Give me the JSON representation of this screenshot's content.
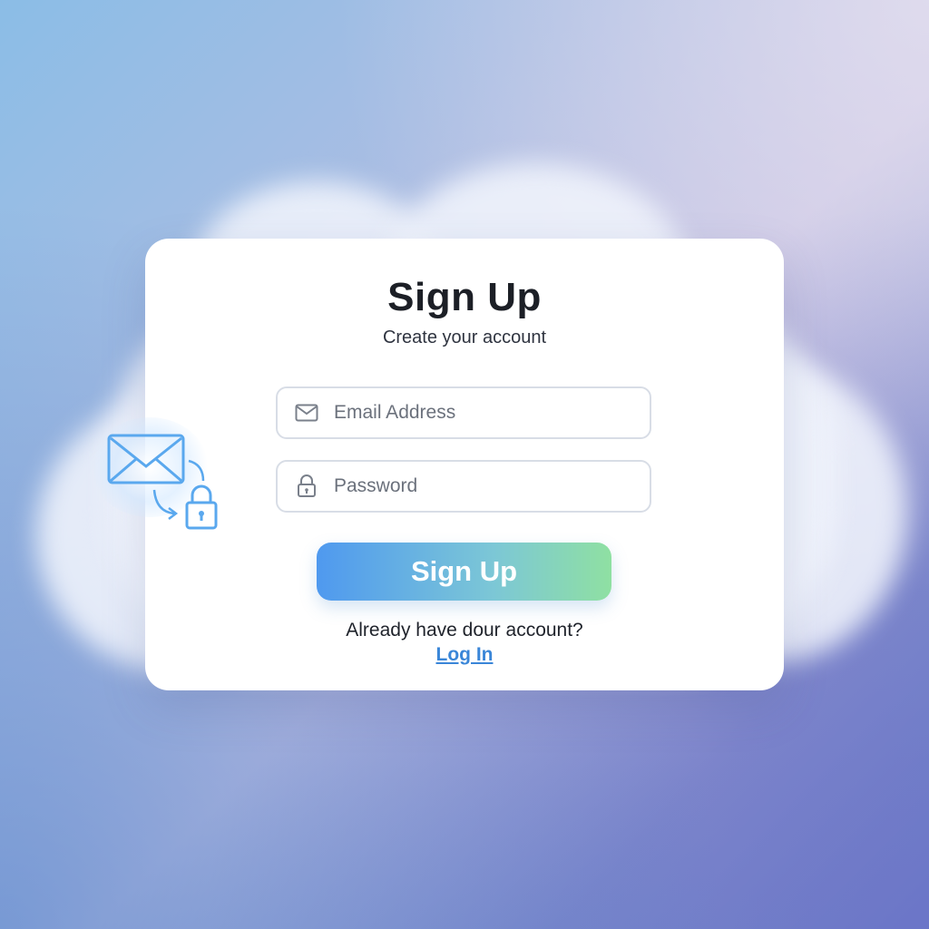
{
  "form": {
    "title": "Sign Up",
    "subtitle": "Create your account",
    "email": {
      "placeholder": "Email Address",
      "value": "",
      "icon": "envelope-icon"
    },
    "password": {
      "placeholder": "Password",
      "value": "",
      "icon": "lock-icon"
    },
    "submit_label": "Sign Up",
    "already_text": "Already have dour account?",
    "login_label": "Log In"
  },
  "decoration": {
    "icons": [
      "envelope-icon",
      "arrow-icon",
      "padlock-icon"
    ]
  },
  "colors": {
    "accent_start": "#4f99ef",
    "accent_end": "#8fe0a2",
    "link": "#3a86d8",
    "title": "#1c1f26"
  }
}
